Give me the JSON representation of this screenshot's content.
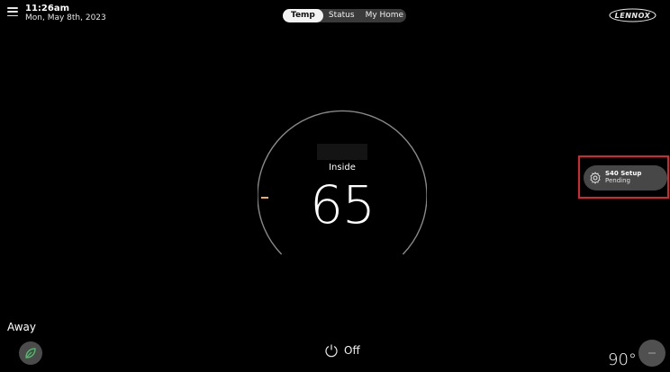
{
  "header": {
    "time": "11:26am",
    "date": "Mon, May 8th, 2023",
    "tabs": [
      {
        "label": "Temp",
        "active": true
      },
      {
        "label": "Status",
        "active": false
      },
      {
        "label": "My Home",
        "active": false
      }
    ],
    "brand": "LENNOX"
  },
  "thermostat": {
    "inside_label": "Inside",
    "inside_temp": "65",
    "accent_color": "#f5b23a"
  },
  "setup_chip": {
    "title": "S40 Setup",
    "subtitle": "Pending",
    "highlight_color": "#d7262e"
  },
  "footer": {
    "mode_label": "Away",
    "leaf_color": "#52c06b",
    "power_label": "Off",
    "outdoor_temp": "90°"
  }
}
